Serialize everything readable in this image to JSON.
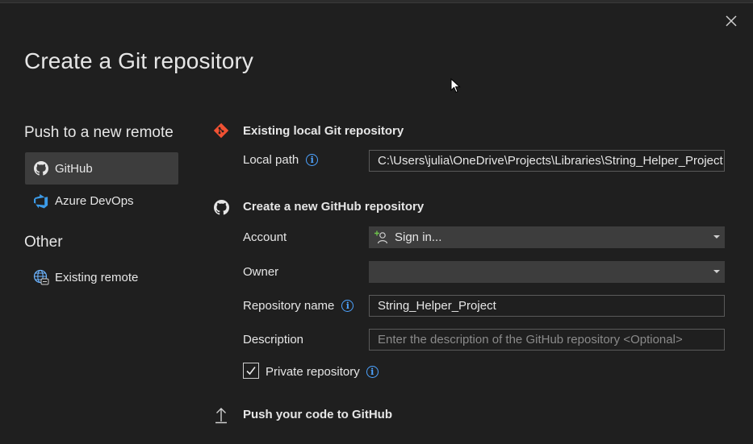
{
  "dialog": {
    "title": "Create a Git repository"
  },
  "sidebar": {
    "push_header": "Push to a new remote",
    "push_items": [
      {
        "label": "GitHub",
        "icon": "github-icon",
        "selected": true
      },
      {
        "label": "Azure DevOps",
        "icon": "azure-devops-icon",
        "selected": false
      }
    ],
    "other_header": "Other",
    "other_items": [
      {
        "label": "Existing remote",
        "icon": "globe-icon"
      }
    ]
  },
  "local": {
    "title": "Existing local Git repository",
    "path_label": "Local path",
    "path_value": "C:\\Users\\julia\\OneDrive\\Projects\\Libraries\\String_Helper_Project"
  },
  "github": {
    "title": "Create a new GitHub repository",
    "account_label": "Account",
    "account_value": "Sign in...",
    "owner_label": "Owner",
    "owner_value": "",
    "repo_name_label": "Repository name",
    "repo_name_value": "String_Helper_Project",
    "description_label": "Description",
    "description_placeholder": "Enter the description of the GitHub repository <Optional>",
    "private_label": "Private repository",
    "private_checked": true
  },
  "push": {
    "title": "Push your code to GitHub"
  },
  "colors": {
    "background": "#1f1f1f",
    "selected": "#3d3d3d",
    "accent_info": "#4da3ff",
    "git_icon": "#f05133",
    "azure_icon": "#3c9be8"
  }
}
